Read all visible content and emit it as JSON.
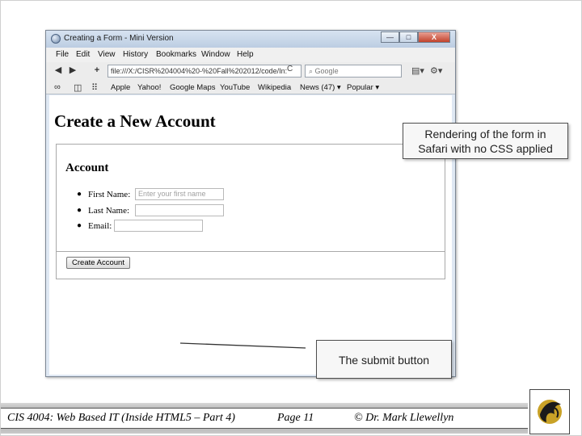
{
  "browser": {
    "title": "Creating a Form - Mini Version",
    "window_buttons": {
      "minimize": "—",
      "maximize": "□",
      "close": "X"
    },
    "menu": [
      "File",
      "Edit",
      "View",
      "History",
      "Bookmarks",
      "Window",
      "Help"
    ],
    "nav": {
      "back": "◀",
      "forward": "▶",
      "add": "+",
      "url": "file:///X:/CISR%204004%20-%20Fall%202012/code/In:",
      "reload": "C",
      "search_placeholder": "Google"
    },
    "bookmarks": [
      "Apple",
      "Yahoo!",
      "Google Maps",
      "YouTube",
      "Wikipedia",
      "News (47) ▾",
      "Popular ▾"
    ]
  },
  "page": {
    "heading": "Create a New Account",
    "legend": "Account",
    "fields": [
      {
        "label": "First Name:",
        "placeholder": "Enter your first name"
      },
      {
        "label": "Last Name:",
        "placeholder": ""
      },
      {
        "label": "Email:",
        "placeholder": ""
      }
    ],
    "submit_label": "Create Account"
  },
  "callouts": {
    "rendering_line1": "Rendering of the form in",
    "rendering_line2": "Safari with no CSS applied",
    "submit": "The submit button"
  },
  "footer": {
    "course": "CIS 4004: Web Based IT (Inside HTML5 – Part 4)",
    "page": "Page 11",
    "author": "© Dr. Mark Llewellyn"
  }
}
